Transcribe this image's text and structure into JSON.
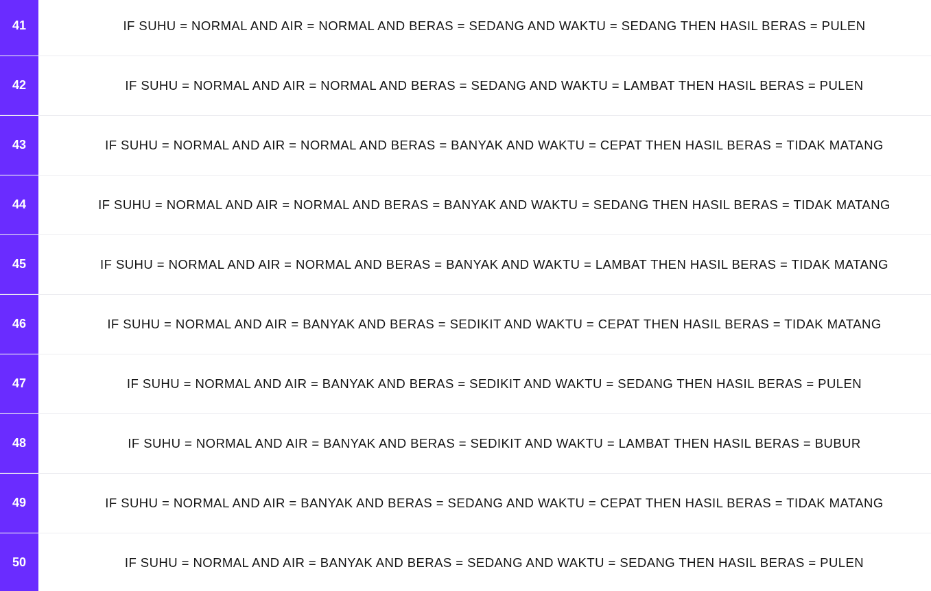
{
  "rules": [
    {
      "number": "41",
      "text": "IF SUHU = NORMAL AND AIR = NORMAL AND BERAS = SEDANG AND WAKTU = SEDANG THEN HASIL BERAS = PULEN"
    },
    {
      "number": "42",
      "text": "IF SUHU = NORMAL AND AIR = NORMAL AND BERAS = SEDANG AND WAKTU = LAMBAT THEN HASIL BERAS = PULEN"
    },
    {
      "number": "43",
      "text": "IF SUHU = NORMAL AND AIR = NORMAL AND BERAS = BANYAK AND WAKTU = CEPAT THEN HASIL BERAS = TIDAK MATANG"
    },
    {
      "number": "44",
      "text": "IF SUHU = NORMAL AND AIR = NORMAL AND BERAS = BANYAK AND WAKTU = SEDANG THEN HASIL BERAS = TIDAK MATANG"
    },
    {
      "number": "45",
      "text": "IF SUHU = NORMAL AND AIR = NORMAL AND BERAS = BANYAK AND WAKTU = LAMBAT THEN HASIL BERAS = TIDAK MATANG"
    },
    {
      "number": "46",
      "text": "IF SUHU = NORMAL AND AIR = BANYAK AND BERAS = SEDIKIT AND WAKTU = CEPAT THEN HASIL BERAS = TIDAK MATANG"
    },
    {
      "number": "47",
      "text": "IF SUHU = NORMAL AND AIR = BANYAK AND BERAS = SEDIKIT AND WAKTU = SEDANG THEN HASIL BERAS = PULEN"
    },
    {
      "number": "48",
      "text": "IF SUHU = NORMAL AND AIR = BANYAK AND BERAS = SEDIKIT AND WAKTU = LAMBAT THEN HASIL BERAS = BUBUR"
    },
    {
      "number": "49",
      "text": "IF SUHU = NORMAL AND AIR = BANYAK AND BERAS = SEDANG AND WAKTU = CEPAT THEN HASIL BERAS = TIDAK MATANG"
    },
    {
      "number": "50",
      "text": "IF SUHU = NORMAL AND AIR = BANYAK AND BERAS = SEDANG AND WAKTU = SEDANG THEN HASIL BERAS = PULEN"
    }
  ],
  "colors": {
    "accent": "#6a2cff",
    "number_text": "#ffffff",
    "rule_text": "#141414",
    "divider": "#ececf0"
  }
}
